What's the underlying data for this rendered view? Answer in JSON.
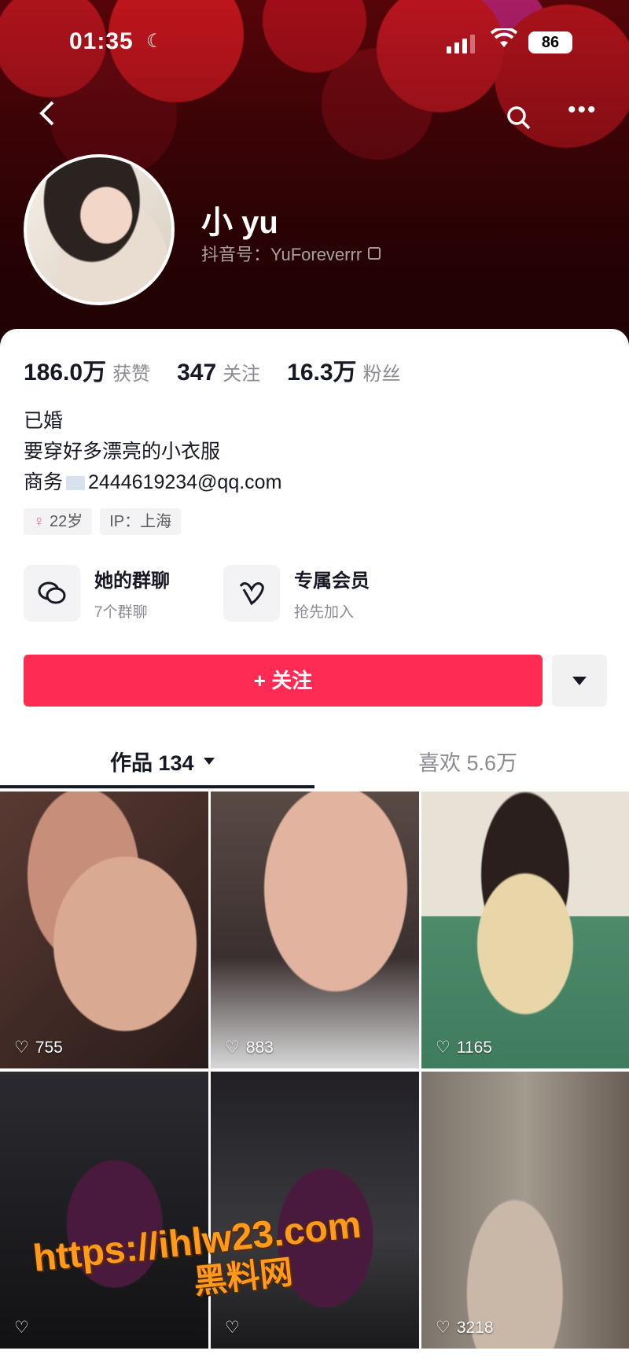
{
  "status_bar": {
    "time": "01:35",
    "battery": "86"
  },
  "profile": {
    "name": "小 yu",
    "douyin_id": "抖音号：YuForeverrr",
    "stats": [
      {
        "num": "186.0万",
        "label": "获赞"
      },
      {
        "num": "347",
        "label": "关注"
      },
      {
        "num": "16.3万",
        "label": "粉丝"
      }
    ],
    "bio": {
      "line1": "已婚",
      "line2": "要穿好多漂亮的小衣服",
      "line3_prefix": "商务",
      "line3_email": "2444619234@qq.com"
    },
    "tags": {
      "age": "22岁",
      "ip": "IP：上海"
    }
  },
  "features": [
    {
      "title": "她的群聊",
      "sub": "7个群聊"
    },
    {
      "title": "专属会员",
      "sub": "抢先加入"
    }
  ],
  "follow_label": "+ 关注",
  "tabs": {
    "works": "作品 134",
    "likes": "喜欢 5.6万"
  },
  "videos": [
    {
      "likes": "755"
    },
    {
      "likes": "883"
    },
    {
      "likes": "1165"
    },
    {
      "likes": ""
    },
    {
      "likes": ""
    },
    {
      "likes": "3218"
    }
  ],
  "watermark": {
    "url": "https://ihlw23.com",
    "name": "黑料网"
  },
  "colors": {
    "accent": "#fe2c55",
    "header": "#7a0a12"
  }
}
